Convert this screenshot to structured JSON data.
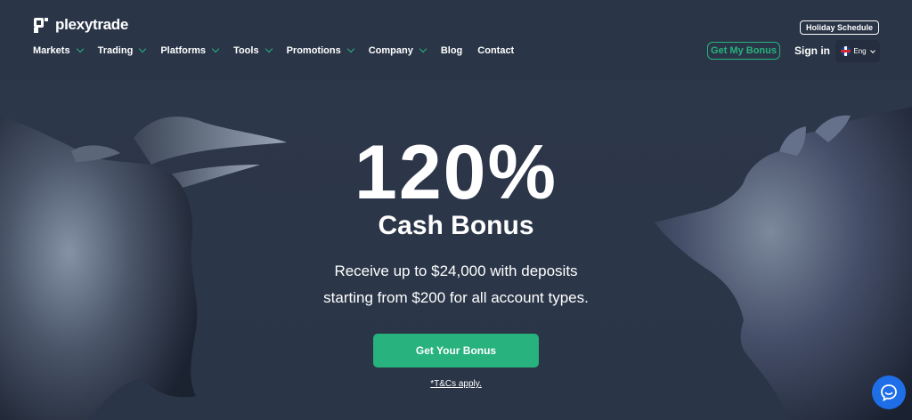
{
  "brand": {
    "logo_text": "plexytrade",
    "accent_color": "#27b27e",
    "background_color": "#2a3547"
  },
  "header": {
    "holiday_schedule_label": "Holiday Schedule",
    "nav": [
      {
        "label": "Markets",
        "has_dropdown": true
      },
      {
        "label": "Trading",
        "has_dropdown": true
      },
      {
        "label": "Platforms",
        "has_dropdown": true
      },
      {
        "label": "Tools",
        "has_dropdown": true
      },
      {
        "label": "Promotions",
        "has_dropdown": true
      },
      {
        "label": "Company",
        "has_dropdown": true
      },
      {
        "label": "Blog",
        "has_dropdown": false
      },
      {
        "label": "Contact",
        "has_dropdown": false
      }
    ],
    "get_my_bonus_label": "Get My Bonus",
    "sign_in_label": "Sign in",
    "language": {
      "label": "Eng",
      "flag_icon": "uk-flag-icon"
    }
  },
  "hero": {
    "headline": "120%",
    "subheadline": "Cash Bonus",
    "description_line1": "Receive up to $24,000 with deposits",
    "description_line2": "starting from $200 for all account types.",
    "cta_label": "Get Your Bonus",
    "terms_label": "*T&Cs apply."
  },
  "chat": {
    "icon": "chat-bubble-icon",
    "color": "#1e6ee8"
  }
}
